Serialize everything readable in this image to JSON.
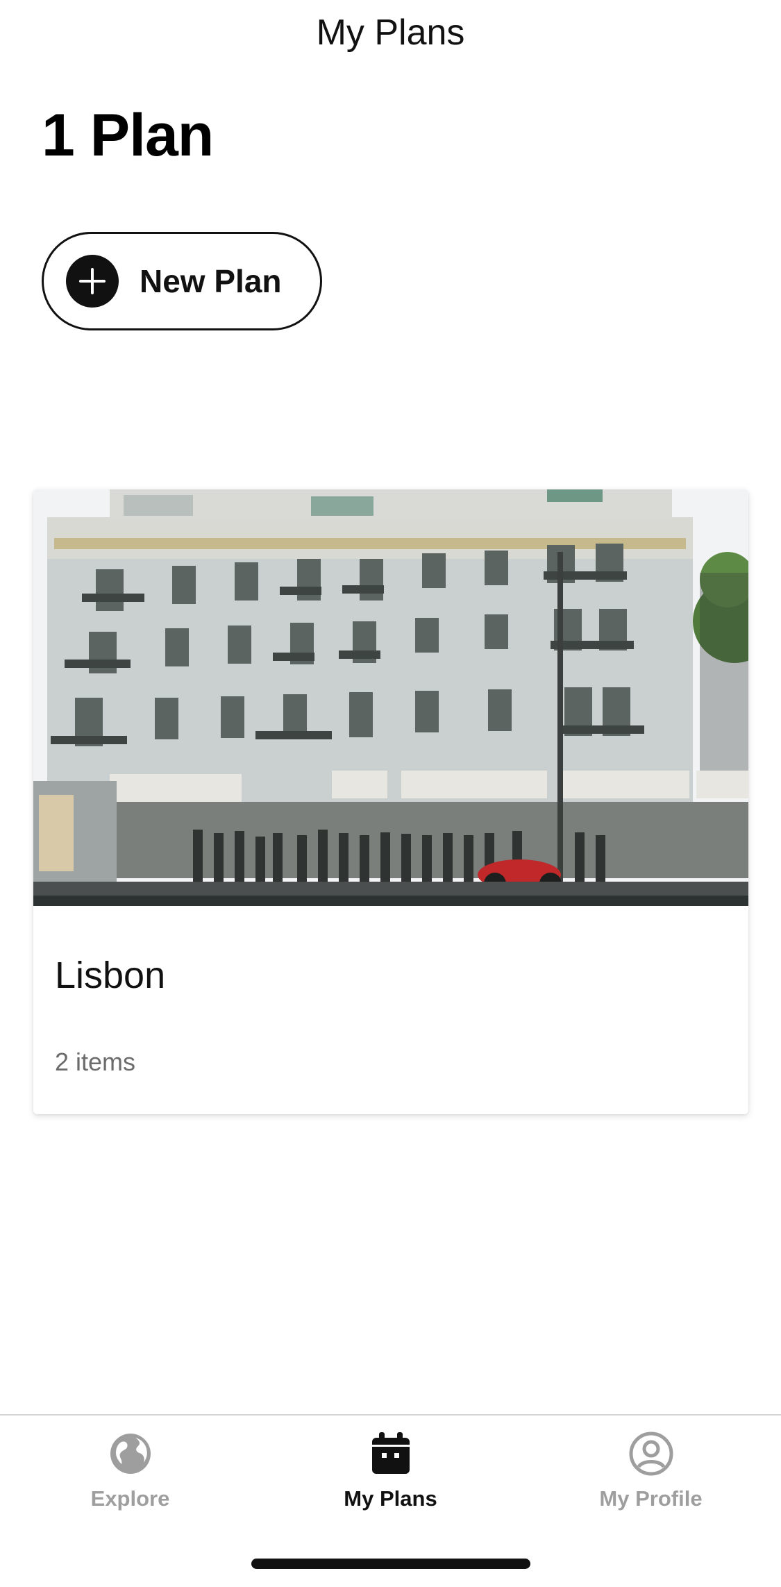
{
  "header": {
    "title": "My Plans"
  },
  "summary": {
    "count_label": "1 Plan"
  },
  "new_plan_button": {
    "label": "New Plan",
    "icon": "plus-icon"
  },
  "plans": [
    {
      "title": "Lisbon",
      "subtitle": "2 items",
      "image": "building-street-photo"
    }
  ],
  "tab_bar": {
    "tabs": [
      {
        "label": "Explore",
        "icon": "globe-icon",
        "active": false
      },
      {
        "label": "My Plans",
        "icon": "calendar-icon",
        "active": true
      },
      {
        "label": "My Profile",
        "icon": "profile-icon",
        "active": false
      }
    ]
  },
  "colors": {
    "primary": "#111111",
    "inactive_tab": "#9e9e9e",
    "secondary_text": "#6b6b6b"
  }
}
